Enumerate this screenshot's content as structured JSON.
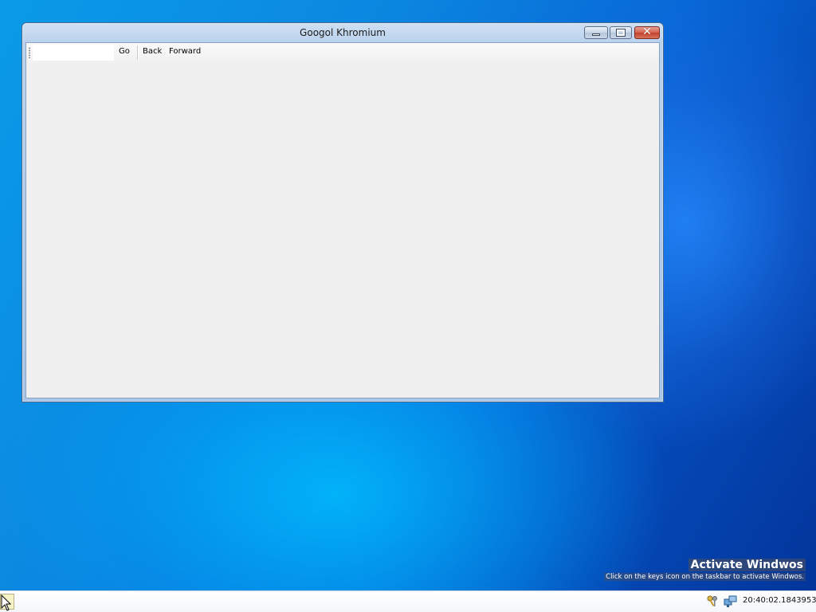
{
  "window": {
    "title": "Googol Khromium",
    "controls": {
      "minimize": "minimize",
      "maximize": "maximize",
      "close": "✕"
    }
  },
  "toolbar": {
    "address_value": "",
    "go_label": "Go",
    "back_label": "Back",
    "forward_label": "Forward"
  },
  "watermark": {
    "title": "Activate Windwos",
    "subtitle": "Click on the keys icon on the taskbar to activate Windwos."
  },
  "taskbar": {
    "clock": "20:40:02.1843953",
    "tray_icons": [
      "keys-icon",
      "network-icon"
    ]
  },
  "colors": {
    "desktop_blue": "#0b86e0",
    "client_bg": "#f0f0f0",
    "close_red": "#c0412b"
  }
}
